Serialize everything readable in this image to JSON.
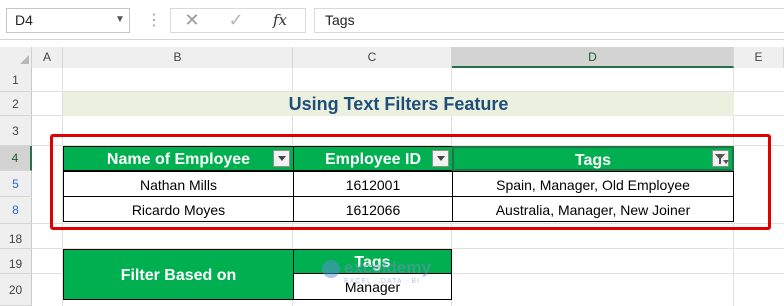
{
  "formula_bar": {
    "name_box": "D4",
    "cancel_icon": "x-icon",
    "enter_icon": "check-icon",
    "fx_label": "fx",
    "formula_value": "Tags"
  },
  "columns": [
    "A",
    "B",
    "C",
    "D",
    "E"
  ],
  "selected_column": "D",
  "rows": [
    "1",
    "2",
    "3",
    "4",
    "5",
    "8",
    "18",
    "19",
    "20"
  ],
  "selected_row": "4",
  "filtered_rows": [
    "5",
    "8"
  ],
  "title": "Using Text Filters Feature",
  "table": {
    "headers": [
      "Name of Employee",
      "Employee ID",
      "Tags"
    ],
    "rows": [
      [
        "Nathan Mills",
        "1612001",
        "Spain, Manager, Old Employee"
      ],
      [
        "Ricardo Moyes",
        "1612066",
        "Australia, Manager, New Joiner"
      ]
    ],
    "filtered_column": "Tags"
  },
  "criteria": {
    "label": "Filter Based on",
    "header": "Tags",
    "value": "Manager"
  },
  "watermark": {
    "name": "exceldemy",
    "tagline": "EXCEL · DATA · BI"
  },
  "colors": {
    "header_green": "#00b050",
    "title_bg": "#ebf1de",
    "title_text": "#1f4e79",
    "highlight_red": "#e00000",
    "filtered_row_number": "#2a6bd1"
  }
}
